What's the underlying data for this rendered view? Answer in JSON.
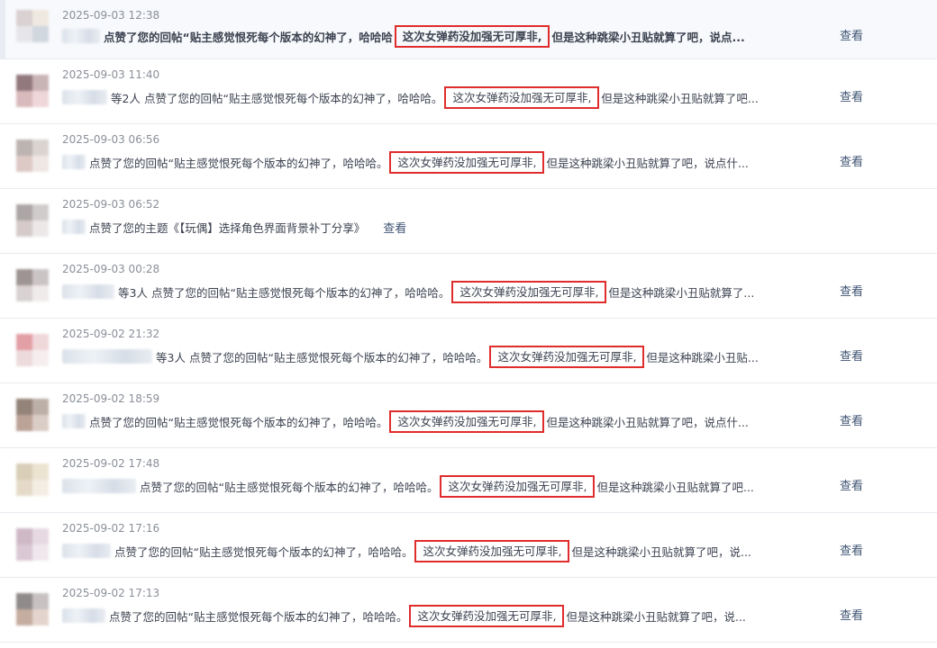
{
  "list": {
    "items": [
      {
        "time": "2025-09-03 12:38",
        "suffix": "",
        "text_a": "点赞了您的回帖“贴主感觉恨死每个版本的幻神了，哈哈哈",
        "highlight": "这次女弹药没加强无可厚非,",
        "text_b": "但是这种跳梁小丑贴就算了吧，说点...",
        "view": "查看"
      },
      {
        "time": "2025-09-03 11:40",
        "suffix": "等2人",
        "text_a": "点赞了您的回帖“贴主感觉恨死每个版本的幻神了，哈哈哈。",
        "highlight": "这次女弹药没加强无可厚非,",
        "text_b": "但是这种跳梁小丑贴就算了吧...",
        "view": "查看"
      },
      {
        "time": "2025-09-03 06:56",
        "suffix": "",
        "text_a": "点赞了您的回帖“贴主感觉恨死每个版本的幻神了，哈哈哈。",
        "highlight": "这次女弹药没加强无可厚非,",
        "text_b": "但是这种跳梁小丑贴就算了吧，说点什...",
        "view": "查看"
      },
      {
        "time": "2025-09-03 06:52",
        "suffix": "",
        "text_a": "点赞了您的主题《【玩偶】选择角色界面背景补丁分享》",
        "highlight": "",
        "text_b": "",
        "view": "查看"
      },
      {
        "time": "2025-09-03 00:28",
        "suffix": "等3人",
        "text_a": "点赞了您的回帖“贴主感觉恨死每个版本的幻神了，哈哈哈。",
        "highlight": "这次女弹药没加强无可厚非,",
        "text_b": "但是这种跳梁小丑贴就算了...",
        "view": "查看"
      },
      {
        "time": "2025-09-02 21:32",
        "suffix": "等3人",
        "text_a": "点赞了您的回帖“贴主感觉恨死每个版本的幻神了，哈哈哈。",
        "highlight": "这次女弹药没加强无可厚非,",
        "text_b": "但是这种跳梁小丑贴...",
        "view": "查看"
      },
      {
        "time": "2025-09-02 18:59",
        "suffix": "",
        "text_a": "点赞了您的回帖“贴主感觉恨死每个版本的幻神了，哈哈哈。",
        "highlight": "这次女弹药没加强无可厚非,",
        "text_b": "但是这种跳梁小丑贴就算了吧，说点什...",
        "view": "查看"
      },
      {
        "time": "2025-09-02 17:48",
        "suffix": "",
        "text_a": "点赞了您的回帖“贴主感觉恨死每个版本的幻神了，哈哈哈。",
        "highlight": "这次女弹药没加强无可厚非,",
        "text_b": "但是这种跳梁小丑贴就算了吧...",
        "view": "查看"
      },
      {
        "time": "2025-09-02 17:16",
        "suffix": "",
        "text_a": "点赞了您的回帖“贴主感觉恨死每个版本的幻神了，哈哈哈。",
        "highlight": "这次女弹药没加强无可厚非,",
        "text_b": "但是这种跳梁小丑贴就算了吧，说...",
        "view": "查看"
      },
      {
        "time": "2025-09-02 17:13",
        "suffix": "",
        "text_a": "点赞了您的回帖“贴主感觉恨死每个版本的幻神了，哈哈哈。",
        "highlight": "这次女弹药没加强无可厚非,",
        "text_b": "但是这种跳梁小丑贴就算了吧，说...",
        "view": "查看"
      }
    ]
  }
}
